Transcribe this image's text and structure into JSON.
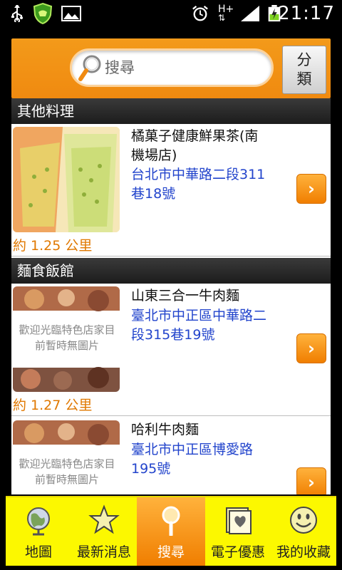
{
  "status_bar": {
    "time": "21:17",
    "data_label": "H+"
  },
  "search": {
    "placeholder": "搜尋",
    "category_button": "分\n類"
  },
  "sections": [
    {
      "title": "其他料理",
      "items": [
        {
          "name": "橘菓子健康鮮果茶(南機場店)",
          "address": "台北市中華路二段311巷18號",
          "distance": "約 1.25 公里"
        }
      ]
    },
    {
      "title": "麵食飯館",
      "items": [
        {
          "name": "山東三合一牛肉麵",
          "address": "臺北市中正區中華路二段315巷19號",
          "distance": "約 1.27 公里",
          "placeholder_text": "歡迎光臨特色店家目前暫時無圖片"
        },
        {
          "name": "哈利牛肉麵",
          "address": "臺北市中正區博愛路195號",
          "distance": "",
          "placeholder_text": "歡迎光臨特色店家目前暫時無圖片"
        }
      ]
    }
  ],
  "tabs": [
    {
      "label": "地圖",
      "icon": "globe-icon"
    },
    {
      "label": "最新消息",
      "icon": "star-icon"
    },
    {
      "label": "搜尋",
      "icon": "search-icon",
      "active": true
    },
    {
      "label": "電子優惠",
      "icon": "coupon-icon"
    },
    {
      "label": "我的收藏",
      "icon": "smiley-icon"
    }
  ],
  "colors": {
    "accent": "#f08a10",
    "tabbar": "#fcf800",
    "address": "#2244cc",
    "distance": "#e07800"
  }
}
